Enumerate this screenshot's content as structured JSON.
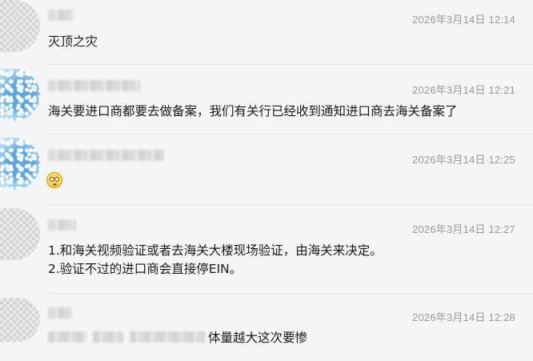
{
  "messages": [
    {
      "time": "2026年3月14日 12:14",
      "lines": [
        "灭顶之灾"
      ]
    },
    {
      "time": "2026年3月14日 12:21",
      "lines": [
        "海关要进口商都要去做备案，我们有关行已经收到通知进口商去海关备案了"
      ]
    },
    {
      "time": "2026年3月14日 12:25",
      "emoji": "flushed-face-emoji"
    },
    {
      "time": "2026年3月14日 12:27",
      "lines": [
        "1.和海关视频验证或者去海关大楼现场验证，由海关来决定。",
        "2.验证不过的进口商会直接停EIN。"
      ]
    },
    {
      "time": "2026年3月14日 12:28",
      "lines": [
        "体量越大这次要惨"
      ]
    }
  ]
}
